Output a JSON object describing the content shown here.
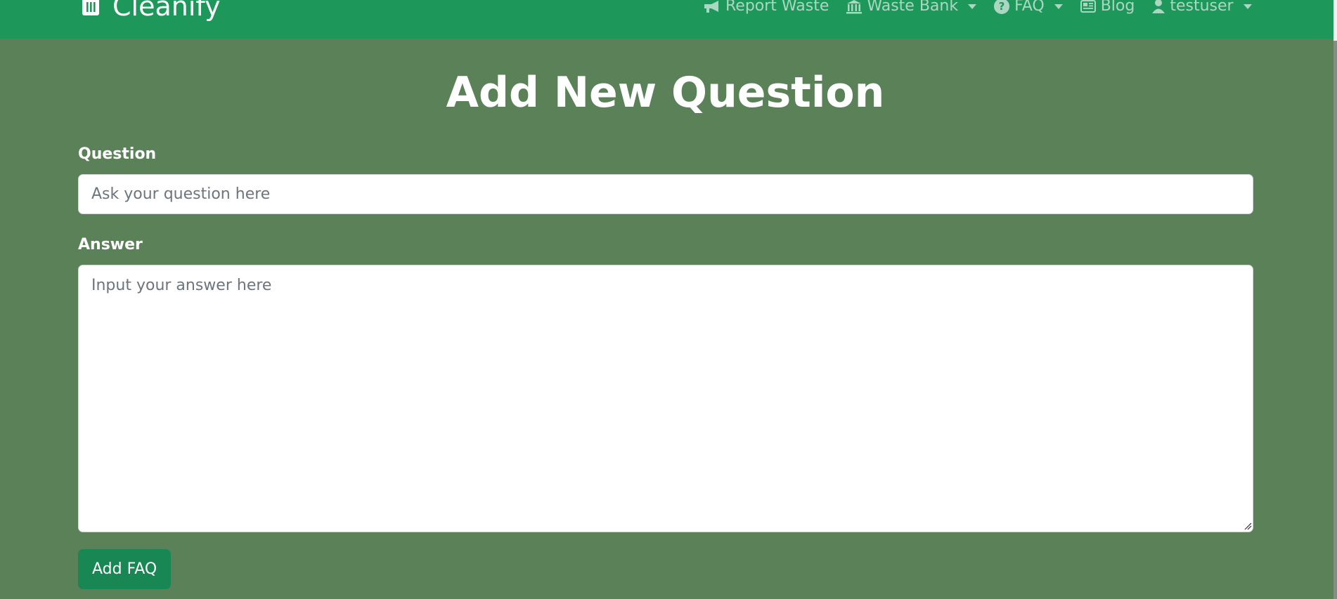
{
  "navbar": {
    "brand": "Cleanify",
    "brand_icon": "trash-bin-icon",
    "items": [
      {
        "label": "Report Waste",
        "icon": "megaphone-icon",
        "dropdown": false
      },
      {
        "label": "Waste Bank",
        "icon": "bank-icon",
        "dropdown": true
      },
      {
        "label": "FAQ",
        "icon": "question-circle-icon",
        "dropdown": true
      },
      {
        "label": "Blog",
        "icon": "newspaper-icon",
        "dropdown": false
      },
      {
        "label": "testuser",
        "icon": "person-icon",
        "dropdown": true
      }
    ]
  },
  "page": {
    "title": "Add New Question"
  },
  "form": {
    "question_label": "Question",
    "question_placeholder": "Ask your question here",
    "question_value": "",
    "answer_label": "Answer",
    "answer_placeholder": "Input your answer here",
    "answer_value": "",
    "submit_label": "Add FAQ"
  },
  "colors": {
    "navbar": "#1e975b",
    "background": "#5a8157",
    "button": "#198754"
  }
}
